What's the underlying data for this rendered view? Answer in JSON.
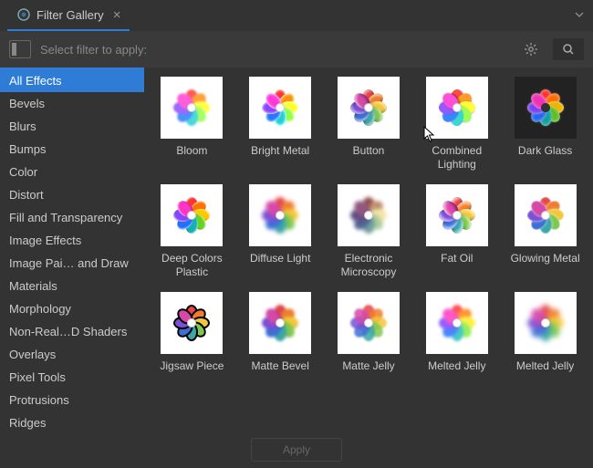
{
  "window": {
    "title": "Filter Gallery"
  },
  "toolbar": {
    "prompt": "Select filter to apply:"
  },
  "sidebar": {
    "selected": 0,
    "items": [
      "All Effects",
      "Bevels",
      "Blurs",
      "Bumps",
      "Color",
      "Distort",
      "Fill and Transparency",
      "Image Effects",
      "Image Pai… and Draw",
      "Materials",
      "Morphology",
      "Non-Real…D Shaders",
      "Overlays",
      "Pixel Tools",
      "Protrusions",
      "Ridges"
    ]
  },
  "filters": [
    {
      "name": "Bloom",
      "variant": "v-bloom"
    },
    {
      "name": "Bright Metal",
      "variant": "v-brightmetal"
    },
    {
      "name": "Button",
      "variant": "v-button"
    },
    {
      "name": "Combined Lighting",
      "variant": "v-combined"
    },
    {
      "name": "Dark Glass",
      "variant": "v-darkglass"
    },
    {
      "name": "Deep Colors Plastic",
      "variant": "v-deepplastic"
    },
    {
      "name": "Diffuse Light",
      "variant": "v-diffuse"
    },
    {
      "name": "Electronic Microscopy",
      "variant": "v-electronic"
    },
    {
      "name": "Fat Oil",
      "variant": "v-fatoil"
    },
    {
      "name": "Glowing Metal",
      "variant": "v-glowmetal"
    },
    {
      "name": "Jigsaw Piece",
      "variant": "v-jigsaw"
    },
    {
      "name": "Matte Bevel",
      "variant": "v-mattebevel"
    },
    {
      "name": "Matte Jelly",
      "variant": "v-mattejelly"
    },
    {
      "name": "Melted Jelly",
      "variant": "v-meltedjelly"
    },
    {
      "name": "Melted Jelly",
      "variant": "v-meltedjelly2"
    }
  ],
  "footer": {
    "apply": "Apply"
  },
  "petal_colors": [
    "#e64545",
    "#f07d2e",
    "#f2c838",
    "#7ec850",
    "#3aa6a6",
    "#3b6fd6",
    "#7a4fd6",
    "#d648a8"
  ]
}
